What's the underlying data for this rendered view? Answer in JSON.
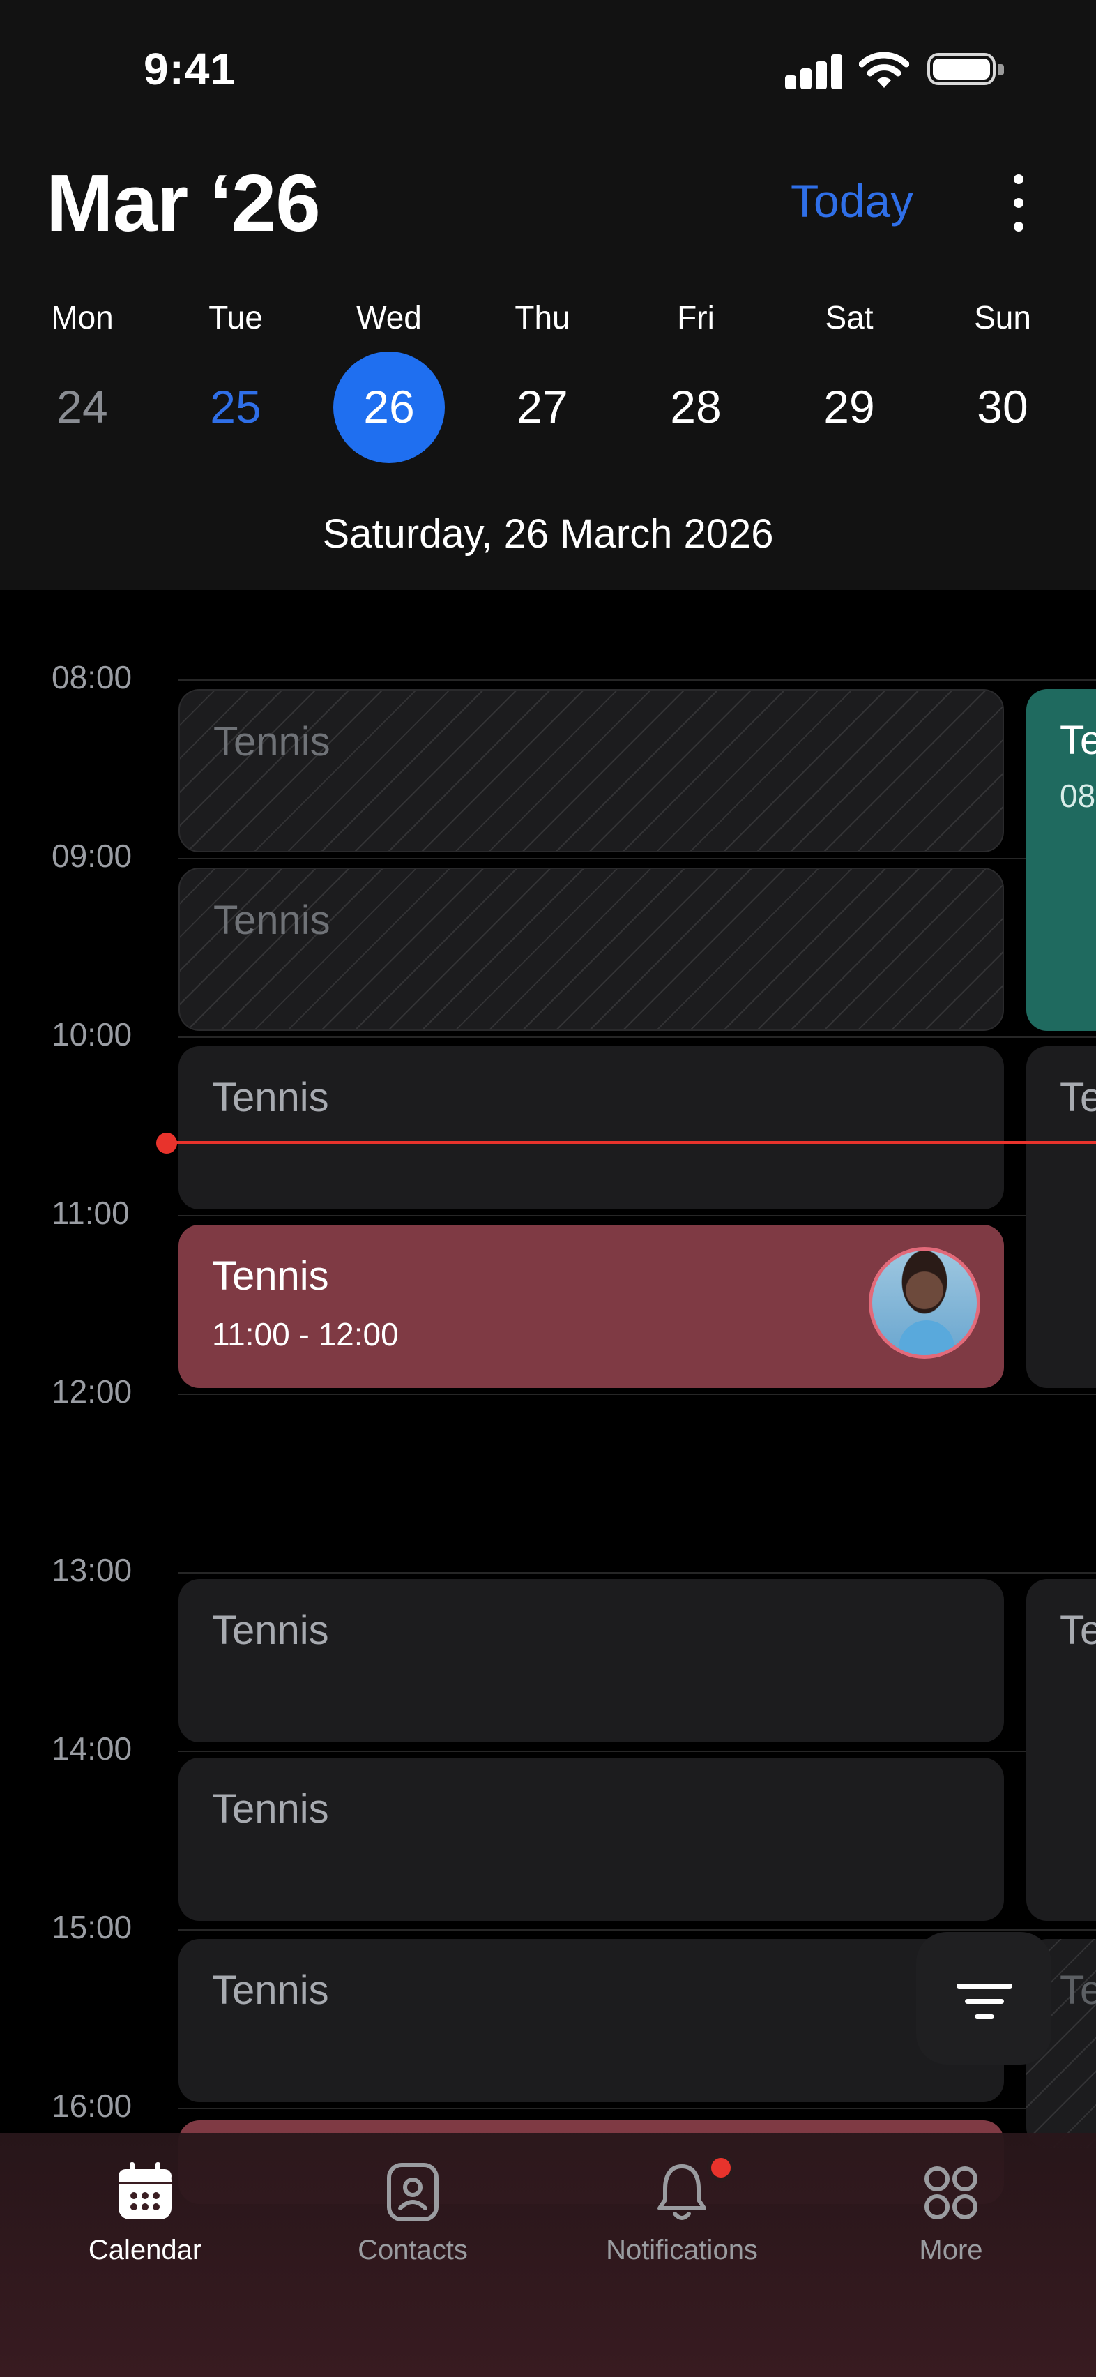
{
  "status_bar": {
    "time": "9:41"
  },
  "header": {
    "month_title": "Mar ‘26",
    "today_label": "Today",
    "full_date": "Saturday, 26 March 2026"
  },
  "week": {
    "days": [
      {
        "weekday": "Mon",
        "date": "24",
        "state": "past"
      },
      {
        "weekday": "Tue",
        "date": "25",
        "state": "accent"
      },
      {
        "weekday": "Wed",
        "date": "26",
        "state": "selected"
      },
      {
        "weekday": "Thu",
        "date": "27",
        "state": "normal"
      },
      {
        "weekday": "Fri",
        "date": "28",
        "state": "normal"
      },
      {
        "weekday": "Sat",
        "date": "29",
        "state": "normal"
      },
      {
        "weekday": "Sun",
        "date": "30",
        "state": "normal"
      }
    ]
  },
  "timeline": {
    "hours": [
      "08:00",
      "09:00",
      "10:00",
      "11:00",
      "12:00",
      "13:00",
      "14:00",
      "15:00",
      "16:00"
    ],
    "events": [
      {
        "title": "Tennis",
        "style": "hatched"
      },
      {
        "title": "Tennis",
        "style": "hatched"
      },
      {
        "title": "Tennis",
        "style": "plain"
      },
      {
        "title": "Tennis",
        "time": "11:00 - 12:00",
        "style": "red",
        "has_avatar": true
      },
      {
        "title": "Tennis",
        "style": "plain"
      },
      {
        "title": "Tennis",
        "style": "plain"
      },
      {
        "title": "Tennis",
        "style": "plain"
      }
    ],
    "side_events": [
      {
        "title": "Te",
        "time": "08",
        "style": "teal"
      },
      {
        "title": "Te",
        "style": "plain"
      },
      {
        "title": "Te",
        "style": "plain"
      },
      {
        "title": "Te",
        "style": "hatched"
      }
    ]
  },
  "tabs": [
    {
      "label": "Calendar",
      "icon": "calendar-icon",
      "active": true
    },
    {
      "label": "Contacts",
      "icon": "contact-icon",
      "active": false
    },
    {
      "label": "Notifications",
      "icon": "bell-icon",
      "active": false,
      "badge": true
    },
    {
      "label": "More",
      "icon": "grid-icon",
      "active": false
    }
  ],
  "colors": {
    "accent": "#1f6ff0",
    "now_indicator": "#e8332c",
    "teal_event": "#1f6a5f",
    "red_event": "#7f3a44",
    "background": "#000000",
    "header_background": "#121212"
  }
}
